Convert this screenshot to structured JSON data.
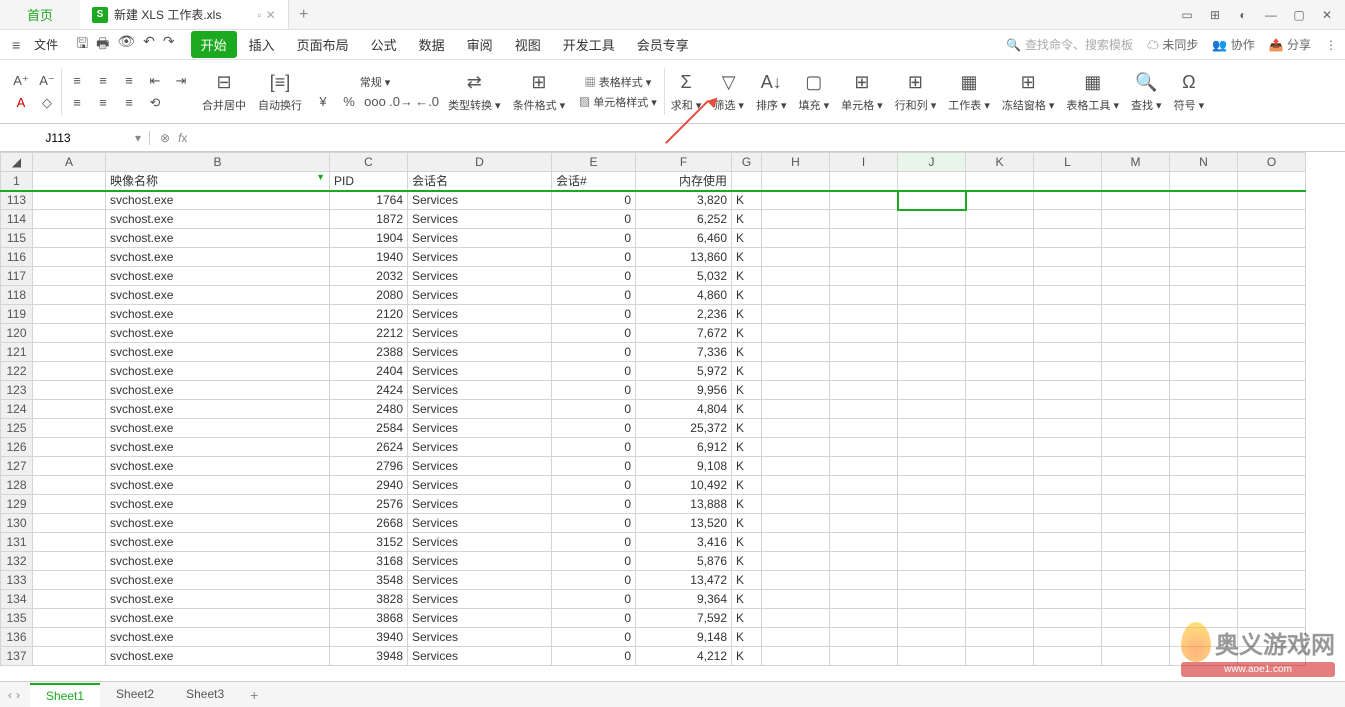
{
  "titlebar": {
    "home": "首页",
    "filename": "新建 XLS 工作表.xls",
    "file_icon": "S"
  },
  "menubar": {
    "file": "文件",
    "tabs": [
      "开始",
      "插入",
      "页面布局",
      "公式",
      "数据",
      "审阅",
      "视图",
      "开发工具",
      "会员专享"
    ],
    "search_ph": "查找命令、搜索模板",
    "sync": "未同步",
    "coop": "协作",
    "share": "分享"
  },
  "ribbon": {
    "merge": "合并居中",
    "wrap": "自动换行",
    "fmt_general": "常规",
    "type_convert": "类型转换",
    "cond_fmt": "条件格式",
    "table_style": "表格样式",
    "cell_style": "单元格样式",
    "sum": "求和",
    "filter": "筛选",
    "sort": "排序",
    "fill": "填充",
    "cell": "单元格",
    "rowcol": "行和列",
    "sheet": "工作表",
    "freeze": "冻结窗格",
    "tools": "表格工具",
    "find": "查找",
    "symbol": "符号"
  },
  "fxbar": {
    "cell": "J113"
  },
  "columns": [
    "A",
    "B",
    "C",
    "D",
    "E",
    "F",
    "G",
    "H",
    "I",
    "J",
    "K",
    "L",
    "M",
    "N",
    "O"
  ],
  "header_row": {
    "num": "1",
    "b": "映像名称",
    "c": "PID",
    "d": "会话名",
    "e": "会话#",
    "f": "内存使用"
  },
  "rows": [
    {
      "n": "113",
      "b": "svchost.exe",
      "c": "1764",
      "d": "Services",
      "e": "0",
      "f": "3,820",
      "g": "K"
    },
    {
      "n": "114",
      "b": "svchost.exe",
      "c": "1872",
      "d": "Services",
      "e": "0",
      "f": "6,252",
      "g": "K"
    },
    {
      "n": "115",
      "b": "svchost.exe",
      "c": "1904",
      "d": "Services",
      "e": "0",
      "f": "6,460",
      "g": "K"
    },
    {
      "n": "116",
      "b": "svchost.exe",
      "c": "1940",
      "d": "Services",
      "e": "0",
      "f": "13,860",
      "g": "K"
    },
    {
      "n": "117",
      "b": "svchost.exe",
      "c": "2032",
      "d": "Services",
      "e": "0",
      "f": "5,032",
      "g": "K"
    },
    {
      "n": "118",
      "b": "svchost.exe",
      "c": "2080",
      "d": "Services",
      "e": "0",
      "f": "4,860",
      "g": "K"
    },
    {
      "n": "119",
      "b": "svchost.exe",
      "c": "2120",
      "d": "Services",
      "e": "0",
      "f": "2,236",
      "g": "K"
    },
    {
      "n": "120",
      "b": "svchost.exe",
      "c": "2212",
      "d": "Services",
      "e": "0",
      "f": "7,672",
      "g": "K"
    },
    {
      "n": "121",
      "b": "svchost.exe",
      "c": "2388",
      "d": "Services",
      "e": "0",
      "f": "7,336",
      "g": "K"
    },
    {
      "n": "122",
      "b": "svchost.exe",
      "c": "2404",
      "d": "Services",
      "e": "0",
      "f": "5,972",
      "g": "K"
    },
    {
      "n": "123",
      "b": "svchost.exe",
      "c": "2424",
      "d": "Services",
      "e": "0",
      "f": "9,956",
      "g": "K"
    },
    {
      "n": "124",
      "b": "svchost.exe",
      "c": "2480",
      "d": "Services",
      "e": "0",
      "f": "4,804",
      "g": "K"
    },
    {
      "n": "125",
      "b": "svchost.exe",
      "c": "2584",
      "d": "Services",
      "e": "0",
      "f": "25,372",
      "g": "K"
    },
    {
      "n": "126",
      "b": "svchost.exe",
      "c": "2624",
      "d": "Services",
      "e": "0",
      "f": "6,912",
      "g": "K"
    },
    {
      "n": "127",
      "b": "svchost.exe",
      "c": "2796",
      "d": "Services",
      "e": "0",
      "f": "9,108",
      "g": "K"
    },
    {
      "n": "128",
      "b": "svchost.exe",
      "c": "2940",
      "d": "Services",
      "e": "0",
      "f": "10,492",
      "g": "K"
    },
    {
      "n": "129",
      "b": "svchost.exe",
      "c": "2576",
      "d": "Services",
      "e": "0",
      "f": "13,888",
      "g": "K"
    },
    {
      "n": "130",
      "b": "svchost.exe",
      "c": "2668",
      "d": "Services",
      "e": "0",
      "f": "13,520",
      "g": "K"
    },
    {
      "n": "131",
      "b": "svchost.exe",
      "c": "3152",
      "d": "Services",
      "e": "0",
      "f": "3,416",
      "g": "K"
    },
    {
      "n": "132",
      "b": "svchost.exe",
      "c": "3168",
      "d": "Services",
      "e": "0",
      "f": "5,876",
      "g": "K"
    },
    {
      "n": "133",
      "b": "svchost.exe",
      "c": "3548",
      "d": "Services",
      "e": "0",
      "f": "13,472",
      "g": "K"
    },
    {
      "n": "134",
      "b": "svchost.exe",
      "c": "3828",
      "d": "Services",
      "e": "0",
      "f": "9,364",
      "g": "K"
    },
    {
      "n": "135",
      "b": "svchost.exe",
      "c": "3868",
      "d": "Services",
      "e": "0",
      "f": "7,592",
      "g": "K"
    },
    {
      "n": "136",
      "b": "svchost.exe",
      "c": "3940",
      "d": "Services",
      "e": "0",
      "f": "9,148",
      "g": "K"
    },
    {
      "n": "137",
      "b": "svchost.exe",
      "c": "3948",
      "d": "Services",
      "e": "0",
      "f": "4,212",
      "g": "K"
    }
  ],
  "sheets": [
    "Sheet1",
    "Sheet2",
    "Sheet3"
  ],
  "watermark": {
    "brand": "奥义游戏网",
    "url": "www.aoe1.com"
  }
}
